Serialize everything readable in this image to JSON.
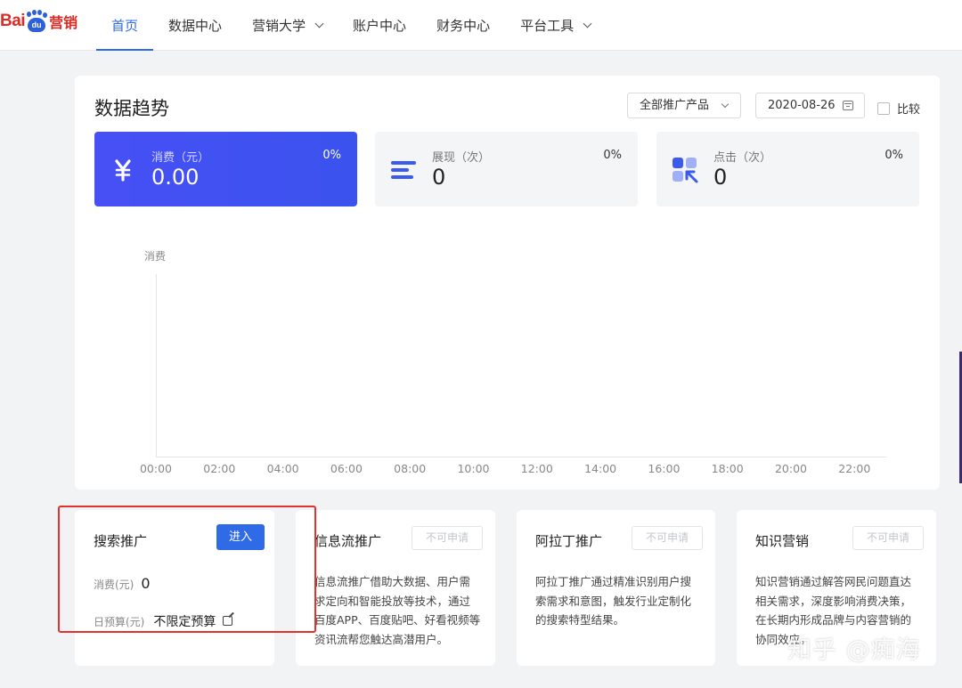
{
  "logo": {
    "bai": "Bai",
    "du": "du",
    "brand": "营销"
  },
  "nav": [
    {
      "label": "首页",
      "active": true,
      "dropdown": false
    },
    {
      "label": "数据中心",
      "active": false,
      "dropdown": false
    },
    {
      "label": "营销大学",
      "active": false,
      "dropdown": true
    },
    {
      "label": "账户中心",
      "active": false,
      "dropdown": false
    },
    {
      "label": "财务中心",
      "active": false,
      "dropdown": false
    },
    {
      "label": "平台工具",
      "active": false,
      "dropdown": true
    }
  ],
  "trend": {
    "title": "数据趋势",
    "product_select": "全部推广产品",
    "date": "2020-08-26",
    "compare_label": "比较",
    "metrics": [
      {
        "label": "消费（元）",
        "value": "0.00",
        "pct": "0%",
        "icon": "yuan-icon"
      },
      {
        "label": "展现（次）",
        "value": "0",
        "pct": "0%",
        "icon": "impressions-icon"
      },
      {
        "label": "点击（次）",
        "value": "0",
        "pct": "0%",
        "icon": "clicks-icon"
      }
    ]
  },
  "chart_data": {
    "type": "line",
    "ylabel": "消费",
    "x": [
      "00:00",
      "02:00",
      "04:00",
      "06:00",
      "08:00",
      "10:00",
      "12:00",
      "14:00",
      "16:00",
      "18:00",
      "20:00",
      "22:00"
    ],
    "series": []
  },
  "cards": [
    {
      "title": "搜索推广",
      "button": "进入",
      "button_enabled": true,
      "spend_label": "消费(元)",
      "spend_value": "0",
      "budget_label": "日预算(元)",
      "budget_value": "不限定预算"
    },
    {
      "title": "信息流推广",
      "button": "不可申请",
      "button_enabled": false,
      "desc": "信息流推广借助大数据、用户需求定向和智能投放等技术，通过百度APP、百度贴吧、好看视频等资讯流帮您触达高潜用户。"
    },
    {
      "title": "阿拉丁推广",
      "button": "不可申请",
      "button_enabled": false,
      "desc": "阿拉丁推广通过精准识别用户搜索需求和意图，触发行业定制化的搜索特型结果。"
    },
    {
      "title": "知识营销",
      "button": "不可申请",
      "button_enabled": false,
      "desc": "知识营销通过解答网民问题直达相关需求，深度影响消费决策，在长期内形成品牌与内容营销的协同效应。"
    }
  ],
  "watermark": "知乎 @痴海",
  "colors": {
    "accent": "#2f6be6",
    "primary_card": "#4750f5",
    "highlight": "#e3312b",
    "logo_red": "#de2b25"
  }
}
